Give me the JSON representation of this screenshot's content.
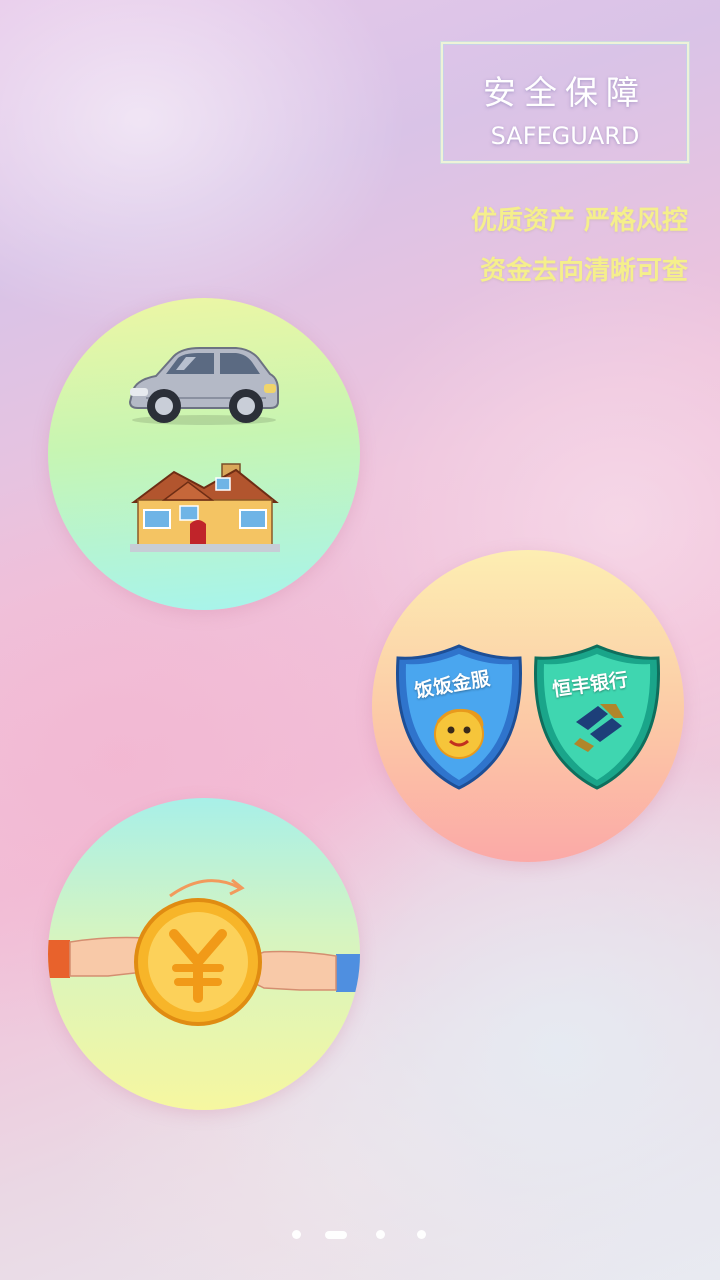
{
  "header": {
    "title_cn": "安全保障",
    "title_en": "SAFEGUARD"
  },
  "slogans": [
    "优质资产 严格风控",
    "资金去向清晰可查"
  ],
  "feature_circles": [
    {
      "icons": [
        "car-icon",
        "house-icon"
      ]
    },
    {
      "badges": [
        {
          "label": "饭饭金服",
          "icon": "smiley-shield-icon",
          "color": "#3f8fe0"
        },
        {
          "label": "恒丰银行",
          "icon": "bank-logo-shield-icon",
          "color": "#2fc7a0"
        }
      ]
    },
    {
      "icons": [
        "coin-exchange-icon"
      ]
    }
  ],
  "pager": {
    "count": 4,
    "active_index": 1
  },
  "colors": {
    "slogan": "#f5ef8c",
    "title": "#ffffff",
    "pager_dot": "#ffffff"
  }
}
